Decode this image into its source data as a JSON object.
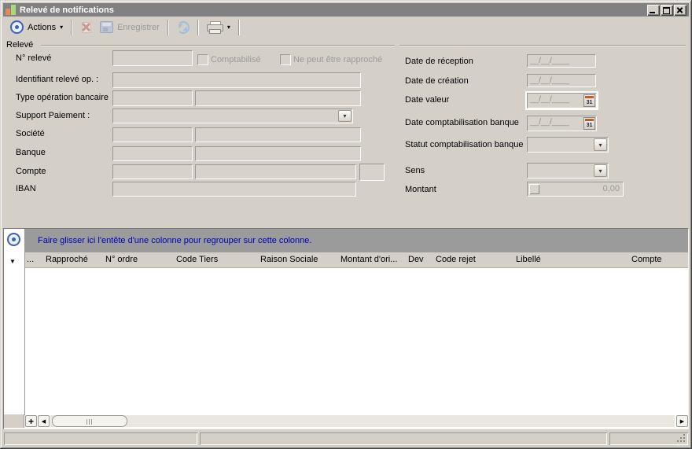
{
  "window": {
    "title": "Relevé de notifications"
  },
  "toolbar": {
    "actions_label": "Actions",
    "save_label": "Enregistrer"
  },
  "form": {
    "group_title": "Relevé",
    "left": {
      "num_releve_label": "N° relevé",
      "comptabilise_label": "Comptabilisé",
      "ne_peut_label": "Ne peut être rapproché",
      "identifiant_label": "Identifiant relevé op. :",
      "type_operation_label": "Type opération bancaire",
      "support_paiement_label": "Support Paiement :",
      "societe_label": "Société",
      "banque_label": "Banque",
      "compte_label": "Compte",
      "iban_label": "IBAN"
    },
    "right": {
      "date_reception_label": "Date de réception",
      "date_creation_label": "Date de création",
      "date_valeur_label": "Date valeur",
      "date_compta_label": "Date comptabilisation banque",
      "statut_compta_label": "Statut comptabilisation banque",
      "sens_label": "Sens",
      "montant_label": "Montant"
    },
    "values": {
      "date_placeholder": "__/__/____",
      "calendar_day": "31",
      "montant_value": "0,00"
    }
  },
  "grid": {
    "group_hint": "Faire glisser ici l'entête d'une colonne pour regrouper sur cette colonne.",
    "columns": [
      "...",
      "Rapproché",
      "N° ordre",
      "Code Tiers",
      "Raison Sociale",
      "Montant d'ori...",
      "Dev",
      "Code rejet",
      "Libellé",
      "Compte"
    ],
    "add_button_label": "+"
  },
  "icons": {
    "actions_caret": "▾",
    "printer_caret": "▾",
    "filter_arrow": "▼",
    "combo_chevron": "▾",
    "scroll_left": "◀",
    "scroll_right": "▶"
  },
  "colors": {
    "window_bg": "#d4d0c8",
    "titlebar_bg": "#818181",
    "titlebar_text": "#ffffff",
    "group_bar_bg": "#9b9b9b",
    "group_bar_text": "#0000c0",
    "disabled_text": "#9a9a9a",
    "calendar_accent": "#c85a28",
    "bullseye_blue": "#3b62b5"
  }
}
